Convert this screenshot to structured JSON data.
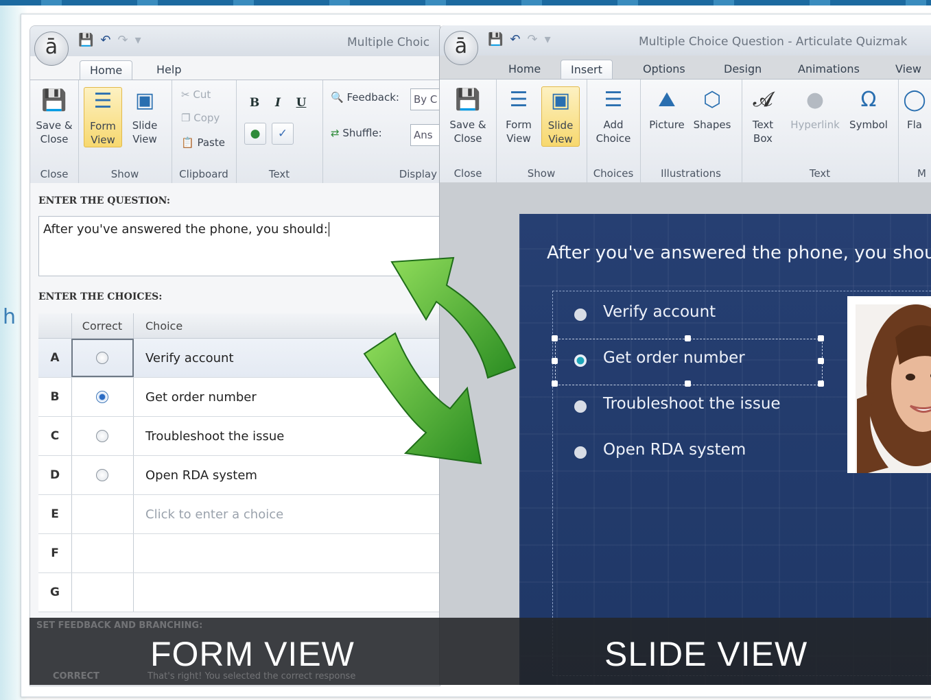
{
  "left_window": {
    "title": "Multiple Choic",
    "tabs": [
      "Home",
      "Help"
    ],
    "ribbon": {
      "groups": {
        "close": "Close",
        "show": "Show",
        "clipboard": "Clipboard",
        "text": "Text",
        "display": "Display"
      },
      "save_close": "Save &\nClose",
      "form_view": "Form\nView",
      "slide_view": "Slide\nView",
      "cut": "Cut",
      "copy": "Copy",
      "paste": "Paste",
      "bold": "B",
      "italic": "I",
      "underline": "U",
      "feedback_label": "Feedback:",
      "feedback_value": "By C",
      "shuffle_label": "Shuffle:",
      "shuffle_value": "Ans"
    },
    "form": {
      "question_label": "ENTER THE QUESTION:",
      "question_value": "After you've answered the phone, you should:",
      "choices_label": "ENTER THE CHOICES:",
      "col_correct": "Correct",
      "col_choice": "Choice",
      "rows": [
        {
          "letter": "A",
          "correct": false,
          "choice": "Verify account"
        },
        {
          "letter": "B",
          "correct": true,
          "choice": "Get order number"
        },
        {
          "letter": "C",
          "correct": false,
          "choice": "Troubleshoot the issue"
        },
        {
          "letter": "D",
          "correct": false,
          "choice": "Open RDA system"
        },
        {
          "letter": "E",
          "correct": null,
          "choice": "Click to enter a choice"
        },
        {
          "letter": "F",
          "correct": null,
          "choice": ""
        },
        {
          "letter": "G",
          "correct": null,
          "choice": ""
        }
      ],
      "feedback_label": "SET FEEDBACK AND BRANCHING:",
      "feedback_row_label": "CORRECT",
      "feedback_row_text": "That's right!  You selected the correct response"
    }
  },
  "right_window": {
    "title": "Multiple Choice Question - Articulate Quizmak",
    "tabs": [
      "Home",
      "Insert",
      "Options",
      "Design",
      "Animations",
      "View"
    ],
    "ribbon": {
      "groups": {
        "close": "Close",
        "show": "Show",
        "choices": "Choices",
        "illustrations": "Illustrations",
        "text": "Text",
        "more": "M"
      },
      "save_close": "Save &\nClose",
      "form_view": "Form\nView",
      "slide_view": "Slide\nView",
      "add_choice": "Add\nChoice",
      "picture": "Picture",
      "shapes": "Shapes",
      "text_box": "Text\nBox",
      "hyperlink": "Hyperlink",
      "symbol": "Symbol",
      "flash": "Fla"
    },
    "slide": {
      "question": "After you've answered the phone, you shoul",
      "options": [
        "Verify account",
        "Get order number",
        "Troubleshoot the issue",
        "Open RDA system"
      ],
      "selected_index": 1
    }
  },
  "captions": {
    "form": "FORM VIEW",
    "slide": "SLIDE VIEW"
  },
  "colors": {
    "arrow_green": "#37a52a",
    "slide_navy": "#233b6c",
    "ribbon_selected": "#f7d86f"
  }
}
